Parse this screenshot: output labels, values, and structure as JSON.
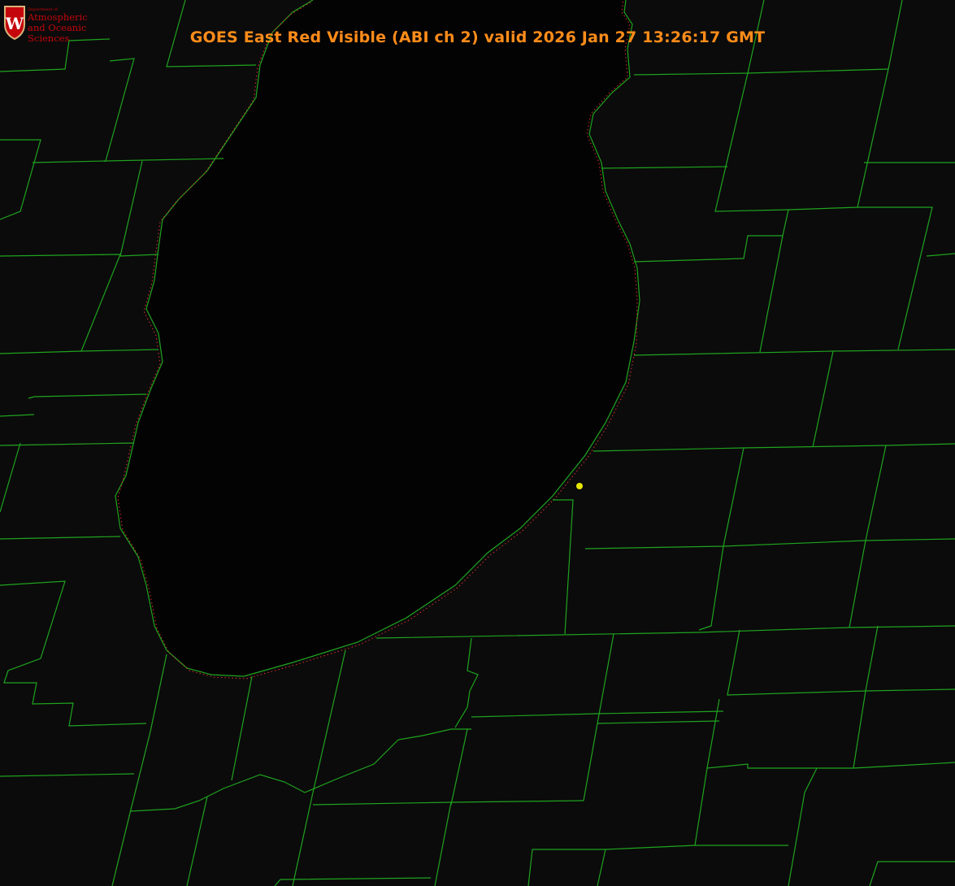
{
  "title": "GOES East Red Visible (ABI ch 2) valid 2026 Jan 27 13:26:17 GMT",
  "logo": {
    "icon": "uw-crest-icon",
    "crest_letter": "W",
    "dept_line": "Department of",
    "line1": "Atmospheric",
    "line2": "and Oceanic Sciences",
    "color": "#c5050c"
  },
  "colors": {
    "title": "#ff8c1a",
    "county_lines": "#1fa31f",
    "coastline_dotted": "#e03030",
    "lake": "#030303",
    "land": "#0b0b0b",
    "marker": "#e6e600"
  }
}
